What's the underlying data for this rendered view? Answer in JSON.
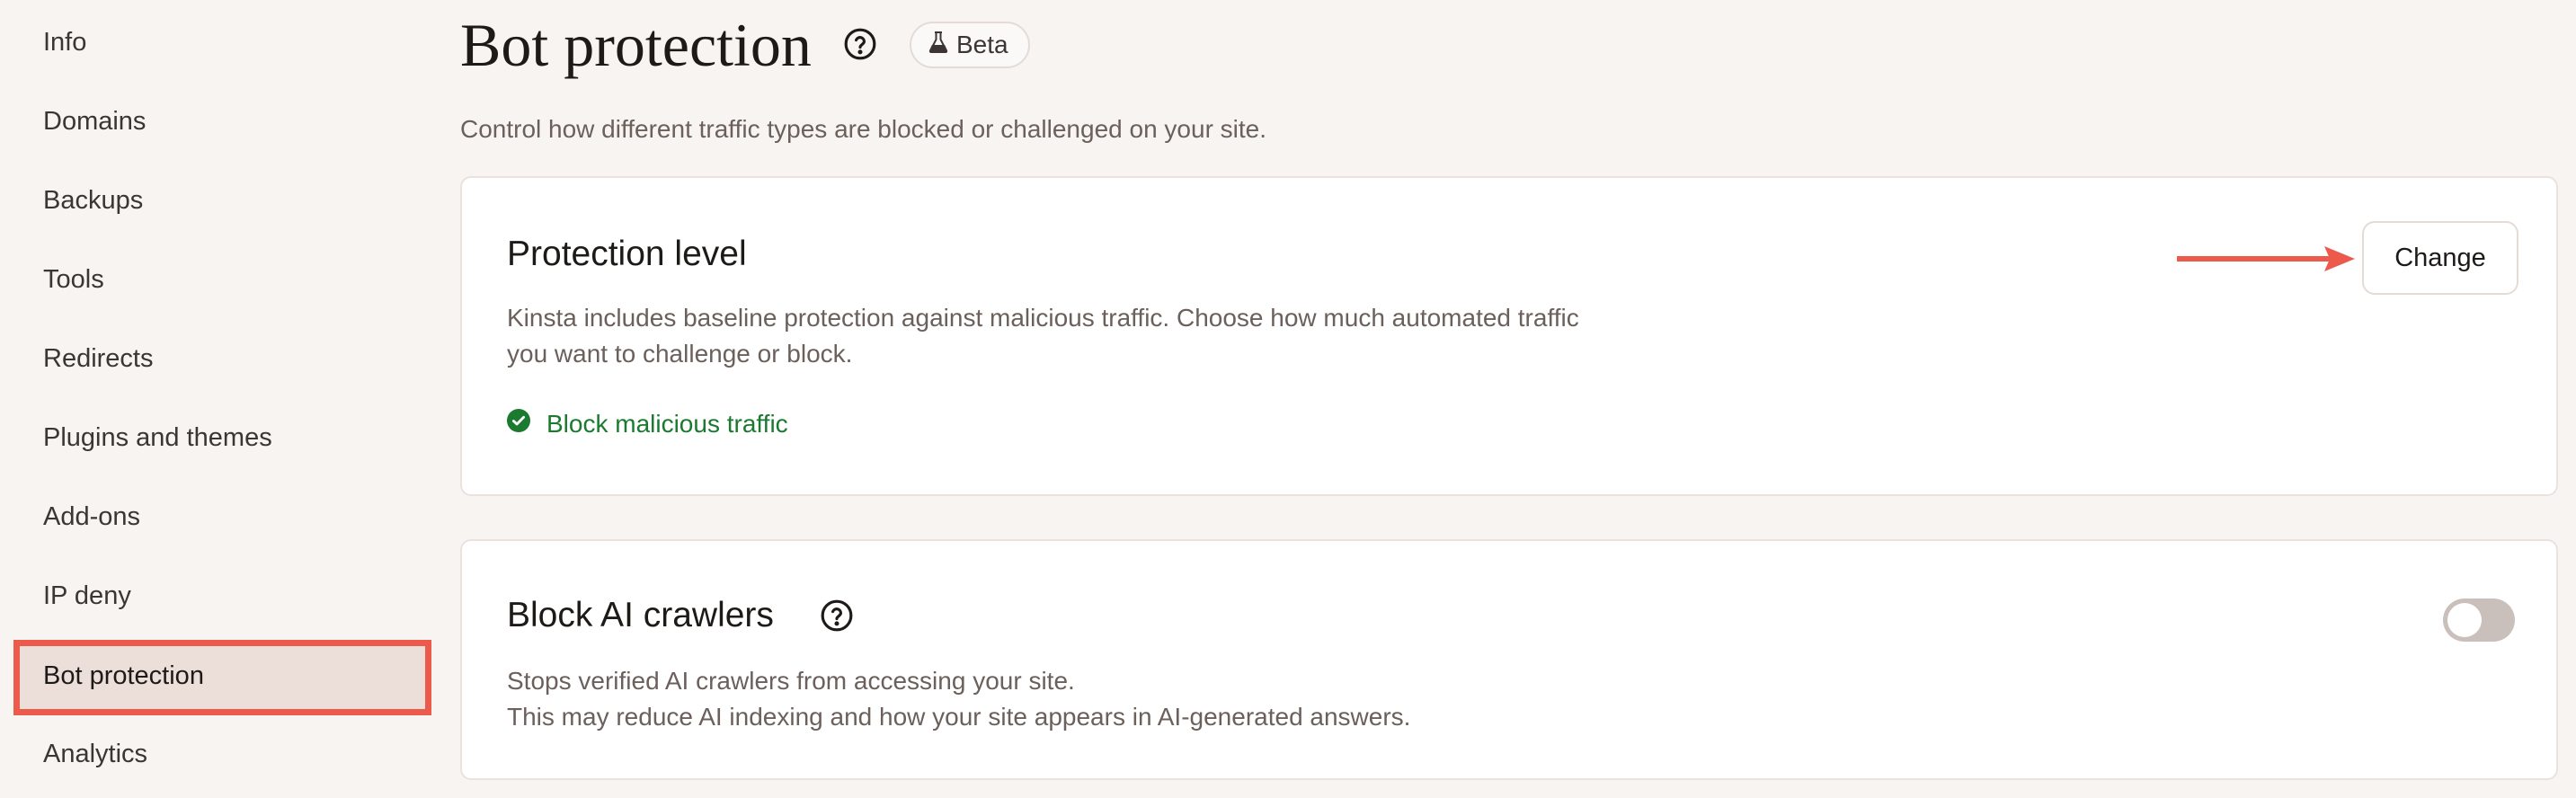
{
  "sidebar": {
    "items": [
      {
        "label": "Info"
      },
      {
        "label": "Domains"
      },
      {
        "label": "Backups"
      },
      {
        "label": "Tools"
      },
      {
        "label": "Redirects"
      },
      {
        "label": "Plugins and themes"
      },
      {
        "label": "Add-ons"
      },
      {
        "label": "IP deny"
      },
      {
        "label": "Bot protection",
        "active": true
      },
      {
        "label": "Analytics"
      }
    ]
  },
  "header": {
    "title": "Bot protection",
    "help_icon": "question-circle-icon",
    "badge_icon": "flask-icon",
    "badge_label": "Beta",
    "subtitle": "Control how different traffic types are blocked or challenged on your site."
  },
  "protection_level": {
    "title": "Protection level",
    "description": "Kinsta includes baseline protection against malicious traffic. Choose how much automated traffic you want to challenge or block.",
    "status_icon": "check-circle-icon",
    "status_label": "Block malicious traffic",
    "change_button": "Change"
  },
  "ai_crawlers": {
    "title": "Block AI crawlers",
    "help_icon": "question-circle-icon",
    "description_line1": "Stops verified AI crawlers from accessing your site.",
    "description_line2": "This may reduce AI indexing and how your site appears in AI-generated answers.",
    "toggle_on": false
  },
  "colors": {
    "accent_highlight": "#ec5a4c",
    "success_green": "#1b7a2f",
    "background": "#f7f4f1"
  }
}
